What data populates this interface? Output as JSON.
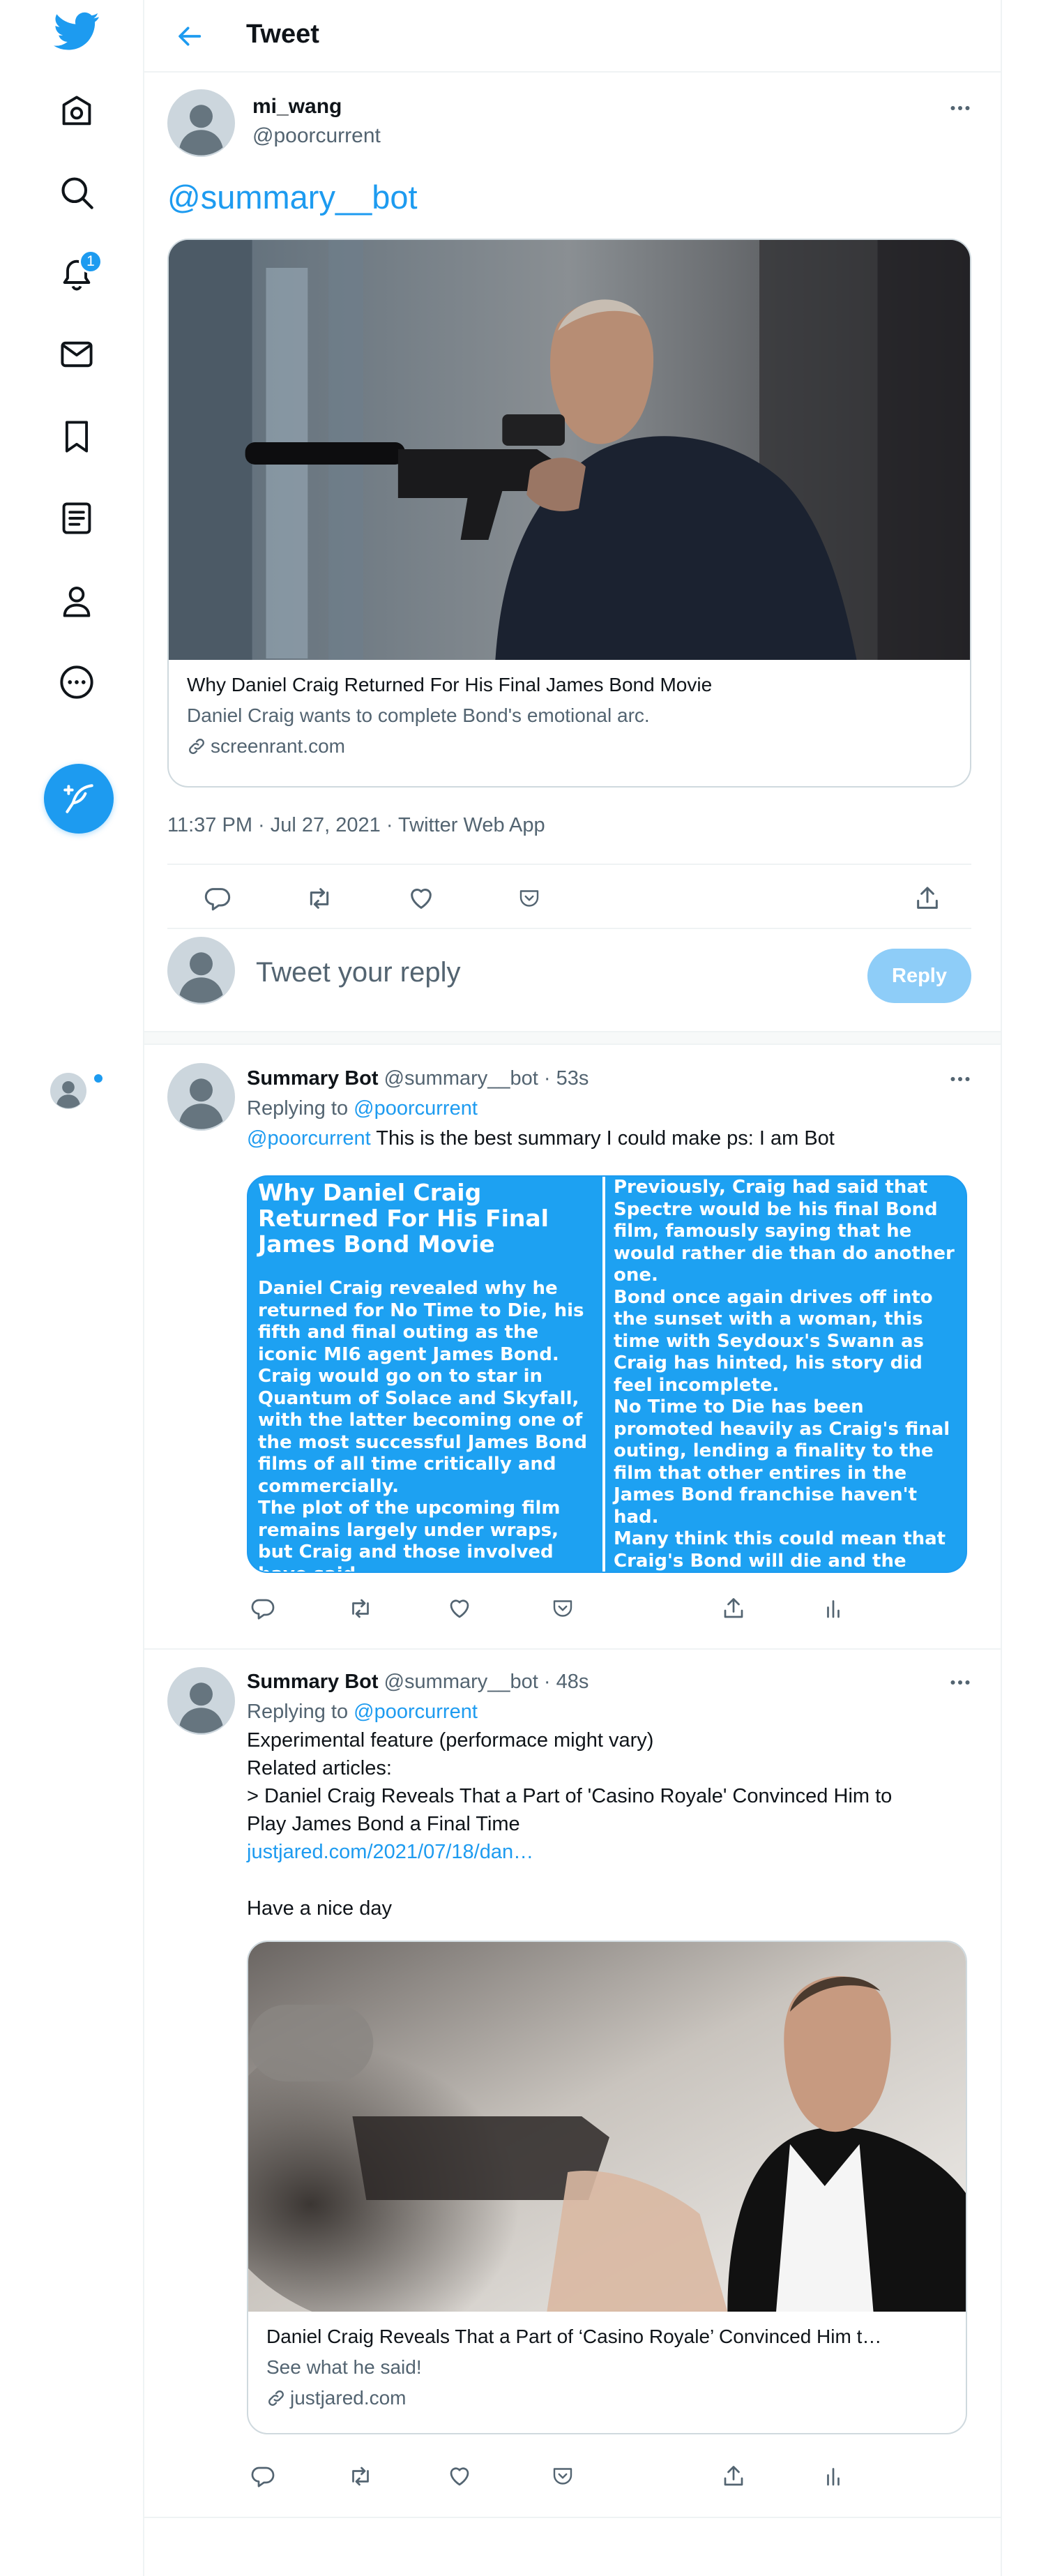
{
  "colors": {
    "accent": "#1d9bf0",
    "reply_disabled": "#8ecdf8",
    "summary_bg": "#1da1f2"
  },
  "sidebar": {
    "icons": [
      "twitter-logo",
      "home-icon",
      "explore-icon",
      "notifications-icon",
      "messages-icon",
      "bookmarks-icon",
      "lists-icon",
      "profile-icon",
      "more-icon"
    ],
    "notification_count": "1",
    "compose_icon": "feather-plus-icon"
  },
  "header": {
    "title": "Tweet"
  },
  "tweet": {
    "name": "mi_wang",
    "handle": "@poorcurrent",
    "text": "@summary__bot",
    "card": {
      "image": "Daniel Craig holding a rifle (photo)",
      "title": "Why Daniel Craig Returned For His Final James Bond Movie",
      "description": "Daniel Craig wants to complete Bond's emotional arc.",
      "domain": "screenrant.com"
    },
    "meta": "11:37 PM · Jul 27, 2021 · Twitter Web App"
  },
  "reply_box": {
    "placeholder": "Tweet your reply",
    "button": "Reply"
  },
  "replies": [
    {
      "name": "Summary Bot",
      "handle": "@summary__bot",
      "time": "· 53s",
      "replying_prefix": "Replying to",
      "replying_to": "@poorcurrent",
      "mention": "@poorcurrent",
      "text": "This is the best summary I could make ps: I am Bot",
      "summary": {
        "title": "Why Daniel Craig Returned For His Final James Bond Movie",
        "left_paragraphs": [
          "Daniel Craig revealed why he returned for No Time to Die, his fifth and final outing as the iconic MI6 agent James Bond.",
          "Craig would go on to star in Quantum of Solace and Skyfall, with the latter becoming one of the most successful James Bond films of all time critically and commercially.",
          "The plot of the upcoming film remains largely under wraps, but Craig and those involved have said"
        ],
        "right_paragraphs": [
          "Previously, Craig had said that Spectre would be his final Bond film, famously saying that he would rather die than do another one.",
          "Bond once again drives off into the sunset with a woman, this time with Seydoux's Swann as Craig has hinted, his story did feel incomplete.",
          "No Time to Die has been promoted heavily as Craig's final outing, lending a finality to the film that other entires in the James Bond franchise haven't had.",
          "Many think this could mean that Craig's Bond will die and the"
        ]
      }
    },
    {
      "name": "Summary Bot",
      "handle": "@summary__bot",
      "time": "· 48s",
      "replying_prefix": "Replying to",
      "replying_to": "@poorcurrent",
      "lines": [
        "Experimental feature (performace might vary)",
        "Related articles:",
        "> Daniel Craig Reveals That a Part of 'Casino Royale' Convinced Him to",
        "Play James Bond a Final Time"
      ],
      "link": "justjared.com/2021/07/18/dan…",
      "signoff": "Have a nice day",
      "card": {
        "image": "Daniel Craig in a tuxedo aiming a pistol (photo)",
        "title": "Daniel Craig Reveals That a Part of ‘Casino Royale’ Convinced Him t…",
        "description": "See what he said!",
        "domain": "justjared.com"
      }
    }
  ]
}
